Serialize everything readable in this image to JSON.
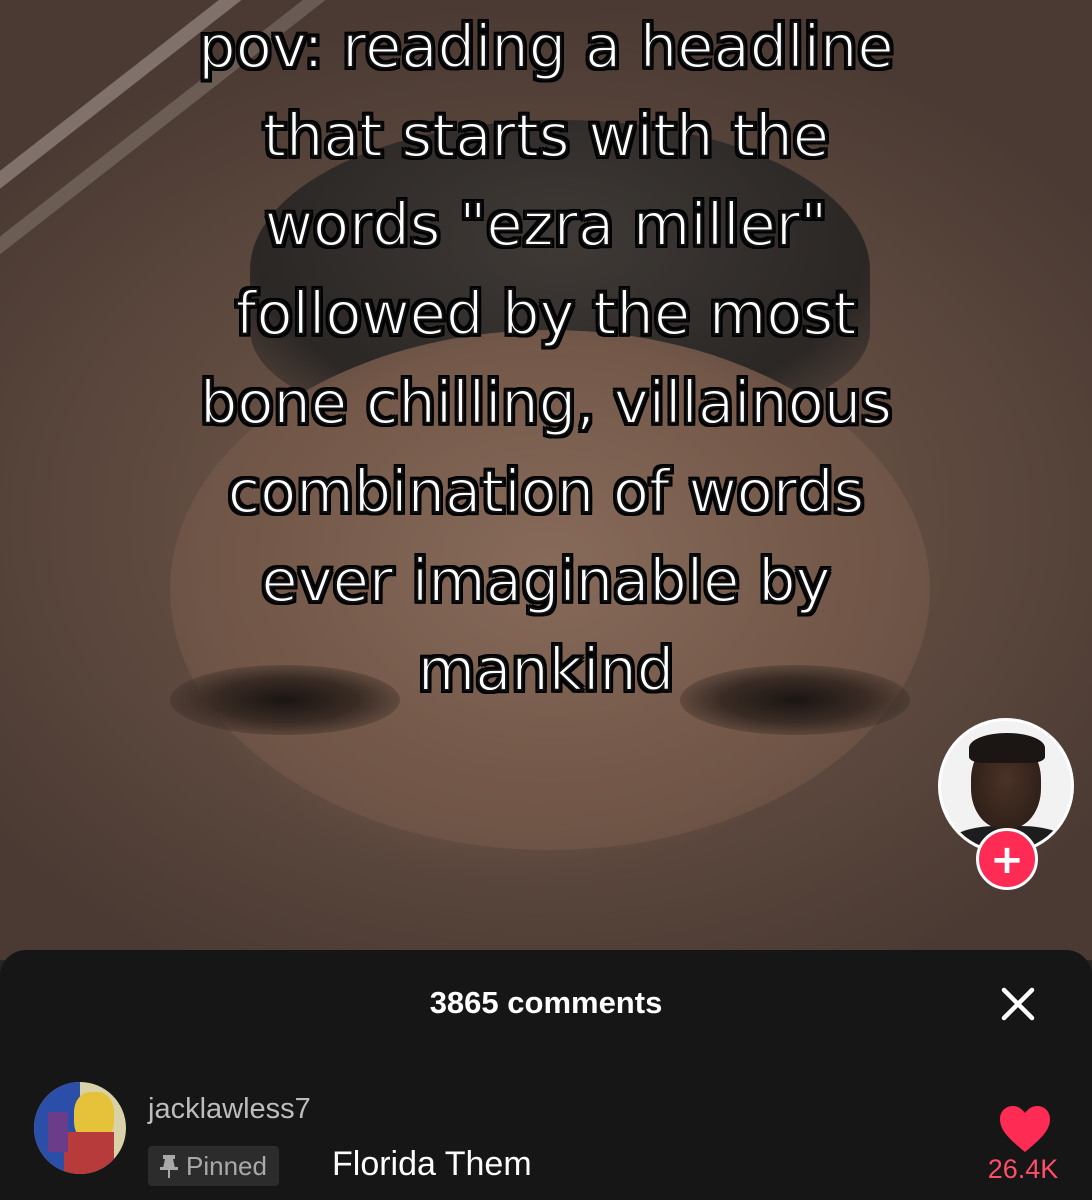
{
  "caption": {
    "lines": [
      "pov: reading a headline",
      "that starts with the",
      "words \"ezra miller\"",
      "followed by the most",
      "bone chilling, villainous",
      "combination of words",
      "ever imaginable by",
      "mankind"
    ]
  },
  "creator": {
    "follow_symbol": "+"
  },
  "comments_sheet": {
    "count_label": "3865 comments",
    "close_icon": "close-icon",
    "comment": {
      "username": "jacklawless7",
      "pinned_label": "Pinned",
      "text": "Florida Them",
      "like_count": "26.4K"
    }
  },
  "colors": {
    "accent": "#fe2c55",
    "like": "#ff4d6a",
    "sheet_background": "#161616"
  }
}
